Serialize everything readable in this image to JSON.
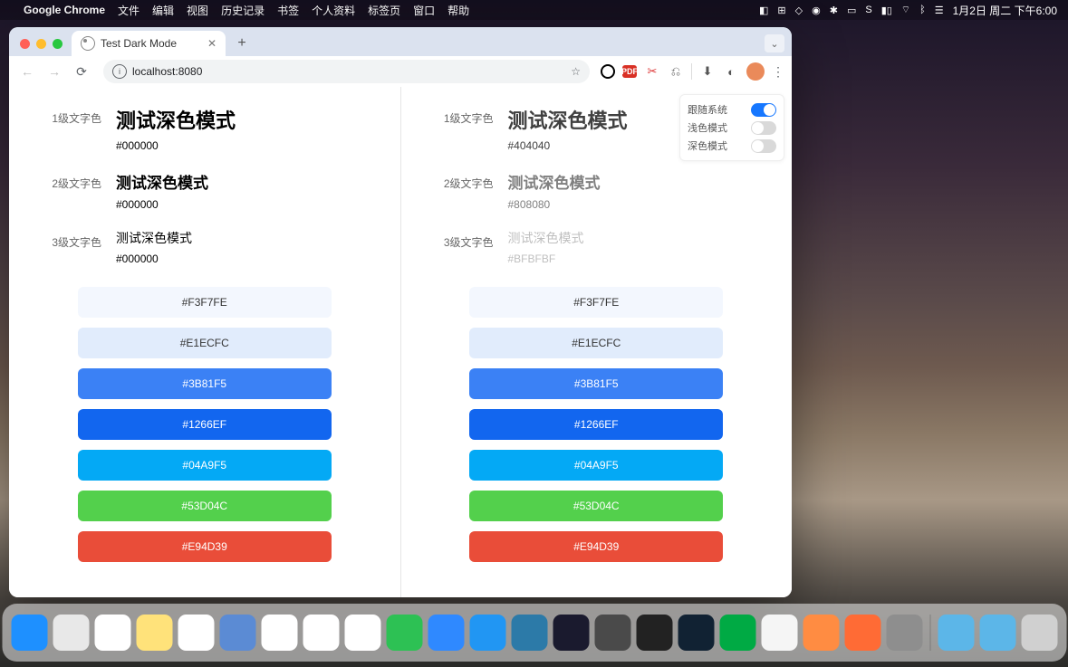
{
  "menubar": {
    "app": "Google Chrome",
    "items": [
      "文件",
      "编辑",
      "视图",
      "历史记录",
      "书签",
      "个人资料",
      "标签页",
      "窗口",
      "帮助"
    ],
    "clock": "1月2日 周二 下午6:00"
  },
  "browser": {
    "tab_title": "Test Dark Mode",
    "url": "localhost:8080"
  },
  "settings": {
    "follow_label": "跟随系统",
    "light_label": "浅色模式",
    "dark_label": "深色模式"
  },
  "page": {
    "heading": "测试深色模式",
    "labels": {
      "l1": "1级文字色",
      "l2": "2级文字色",
      "l3": "3级文字色"
    },
    "left": {
      "h1": "#000000",
      "h2": "#000000",
      "h3": "#000000"
    },
    "right": {
      "h1": "#404040",
      "h2": "#808080",
      "h3": "#BFBFBF"
    },
    "swatches": [
      {
        "hex": "#F3F7FE",
        "text": "light"
      },
      {
        "hex": "#E1ECFC",
        "text": "light"
      },
      {
        "hex": "#3B81F5",
        "text": "dark"
      },
      {
        "hex": "#1266EF",
        "text": "dark"
      },
      {
        "hex": "#04A9F5",
        "text": "dark"
      },
      {
        "hex": "#53D04C",
        "text": "dark"
      },
      {
        "hex": "#E94D39",
        "text": "dark"
      }
    ]
  },
  "dock": {
    "icons": [
      {
        "name": "finder",
        "bg": "#1e90ff"
      },
      {
        "name": "launchpad",
        "bg": "#e8e8e8"
      },
      {
        "name": "reminders",
        "bg": "#ffffff"
      },
      {
        "name": "notes",
        "bg": "#ffe27a"
      },
      {
        "name": "calendar",
        "bg": "#ffffff"
      },
      {
        "name": "preview",
        "bg": "#5b8bd4"
      },
      {
        "name": "chrome",
        "bg": "#ffffff"
      },
      {
        "name": "edge",
        "bg": "#ffffff"
      },
      {
        "name": "safari",
        "bg": "#ffffff"
      },
      {
        "name": "wechat",
        "bg": "#2dc154"
      },
      {
        "name": "messages",
        "bg": "#2f89ff"
      },
      {
        "name": "vscode",
        "bg": "#2196f3"
      },
      {
        "name": "vscode2",
        "bg": "#2c7aa8"
      },
      {
        "name": "affinity",
        "bg": "#1a1a2e"
      },
      {
        "name": "sublime",
        "bg": "#4a4a4a"
      },
      {
        "name": "terminal",
        "bg": "#222"
      },
      {
        "name": "iterm",
        "bg": "#123"
      },
      {
        "name": "warp",
        "bg": "#0a4"
      },
      {
        "name": "kettle",
        "bg": "#f5f5f5"
      },
      {
        "name": "postman",
        "bg": "#ff8c42"
      },
      {
        "name": "swift",
        "bg": "#ff6b35"
      },
      {
        "name": "settings",
        "bg": "#8e8e8e"
      }
    ],
    "right": [
      {
        "name": "folder1",
        "bg": "#5cb6e8"
      },
      {
        "name": "folder2",
        "bg": "#5cb6e8"
      },
      {
        "name": "trash",
        "bg": "#d0d0d0"
      }
    ]
  }
}
